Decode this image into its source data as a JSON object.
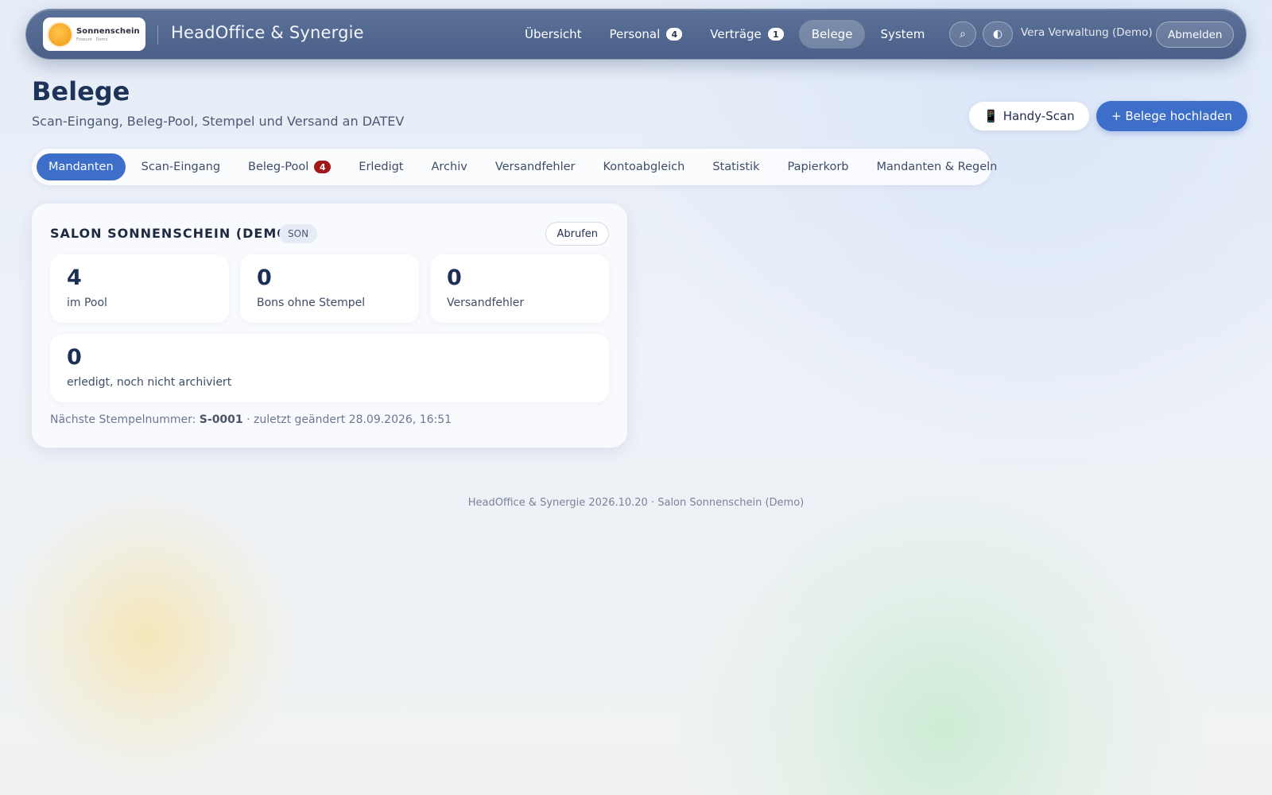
{
  "header": {
    "logo": {
      "name": "Sonnenschein",
      "tagline": "Friseure · Demo"
    },
    "app_title": "HeadOffice & Synergie",
    "nav": [
      {
        "label": "Übersicht",
        "badge": ""
      },
      {
        "label": "Personal",
        "badge": "4"
      },
      {
        "label": "Verträge",
        "badge": "1"
      },
      {
        "label": "Belege",
        "badge": "",
        "active": true
      },
      {
        "label": "System",
        "badge": ""
      }
    ],
    "search_icon": "⌕",
    "theme_icon": "◐",
    "user_name": "Vera Verwaltung (Demo)",
    "logout_label": "Abmelden"
  },
  "page": {
    "title": "Belege",
    "subtitle": "Scan-Eingang, Beleg-Pool, Stempel und Versand an DATEV",
    "scan_icon": "📱",
    "scan_label": "Handy-Scan",
    "upload_label": "+ Belege hochladen"
  },
  "tabs": [
    {
      "label": "Mandanten",
      "badge": "",
      "active": true
    },
    {
      "label": "Scan-Eingang",
      "badge": ""
    },
    {
      "label": "Beleg-Pool",
      "badge": "4"
    },
    {
      "label": "Erledigt",
      "badge": ""
    },
    {
      "label": "Archiv",
      "badge": ""
    },
    {
      "label": "Versandfehler",
      "badge": ""
    },
    {
      "label": "Kontoabgleich",
      "badge": ""
    },
    {
      "label": "Statistik",
      "badge": ""
    },
    {
      "label": "Papierkorb",
      "badge": ""
    },
    {
      "label": "Mandanten & Regeln",
      "badge": ""
    }
  ],
  "client": {
    "name": "SALON SONNENSCHEIN (DEMO)",
    "code": "SON",
    "fetch_label": "Abrufen",
    "stats": [
      {
        "value": "4",
        "label": "im Pool"
      },
      {
        "value": "0",
        "label": "Bons ohne Stempel"
      },
      {
        "value": "0",
        "label": "Versandfehler"
      },
      {
        "value": "0",
        "label": "erledigt, noch nicht archiviert"
      }
    ],
    "stamp_prefix": "Nächste Stempelnummer: ",
    "stamp_number": "S-0001",
    "stamp_suffix": " · zuletzt geändert 28.09.2026, 16:51"
  },
  "footer": "HeadOffice & Synergie 2026.10.20 · Salon Sonnenschein (Demo)",
  "colors": {
    "nav_background": "#4e648c",
    "accent": "#3d6fca",
    "badge_red": "#a31717",
    "heading": "#1e3358"
  }
}
